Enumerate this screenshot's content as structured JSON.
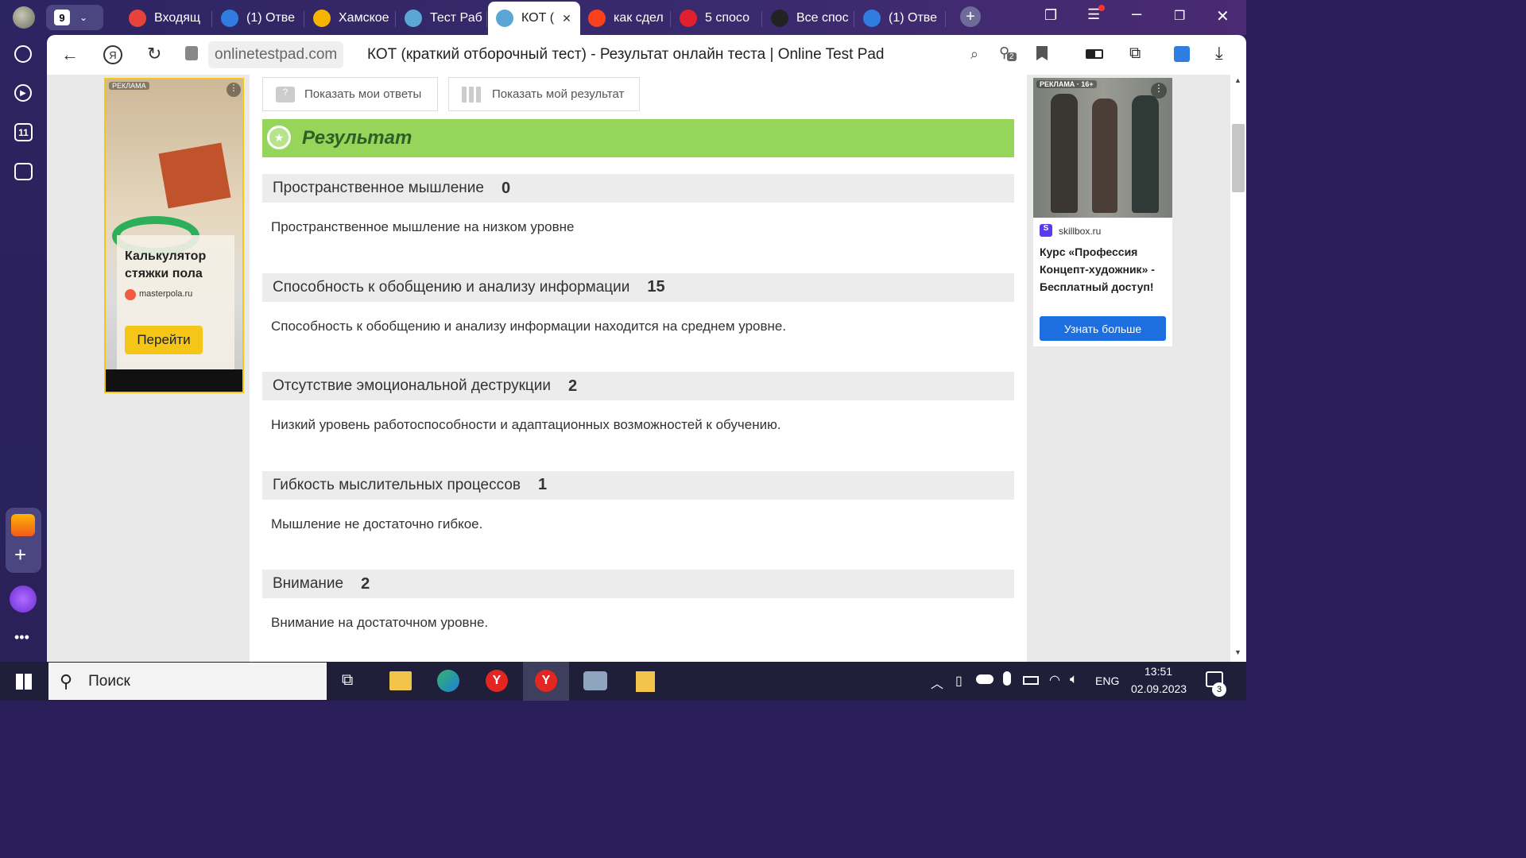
{
  "tabs": {
    "count": "9",
    "items": [
      {
        "label": "Входящ",
        "icon": "mail-icon",
        "color": "#e8433a"
      },
      {
        "label": "(1) Отве",
        "icon": "question-icon",
        "color": "#2f7de1"
      },
      {
        "label": "Хамское",
        "icon": "pencil-icon",
        "color": "#f4b400"
      },
      {
        "label": "Тест Раб",
        "icon": "onlinetestpad-icon",
        "color": "#5aa7d6"
      },
      {
        "label": "КОТ (",
        "icon": "onlinetestpad-icon",
        "color": "#5aa7d6"
      },
      {
        "label": "как сдел",
        "icon": "yandex-icon",
        "color": "#fc3f1d"
      },
      {
        "label": "5 спосо",
        "icon": "medical-icon",
        "color": "#e0202e"
      },
      {
        "label": "Все спос",
        "icon": "spark-icon",
        "color": "#222222"
      },
      {
        "label": "(1) Отве",
        "icon": "question-icon",
        "color": "#2f7de1"
      }
    ]
  },
  "address": {
    "domain": "onlinetestpad.com",
    "title": "КОТ (краткий отборочный тест) - Результат онлайн теста | Online Test Pad",
    "ext_badge": "2"
  },
  "sidebar": {
    "calendar_day": "11"
  },
  "page": {
    "btn_answers": "Показать мои ответы",
    "btn_result": "Показать мой результат",
    "result_title": "Результат",
    "sections": [
      {
        "name": "Пространственное мышление",
        "score": "0",
        "text": "Пространственное мышление на низком уровне"
      },
      {
        "name": "Способность к обобщению и анализу информации",
        "score": "15",
        "text": "Способность к обобщению и анализу информации находится на среднем уровне."
      },
      {
        "name": "Отсутствие эмоциональной деструкции",
        "score": "2",
        "text": "Низкий уровень работоспособности и адаптационных возможностей к обучению."
      },
      {
        "name": "Гибкость мыслительных процессов",
        "score": "1",
        "text": "Мышление не достаточно гибкое."
      },
      {
        "name": "Внимание",
        "score": "2",
        "text": "Внимание на достаточном уровне."
      }
    ]
  },
  "ad_left": {
    "badge": "РЕКЛАМА",
    "title": "Калькулятор стяжки пола",
    "domain": "masterpola.ru",
    "button": "Перейти"
  },
  "ad_right": {
    "badge": "РЕКЛАМА · 16+",
    "domain": "skillbox.ru",
    "title": "Курс «Профессия Концепт-художник» - Бесплатный доступ!",
    "button": "Узнать больше"
  },
  "taskbar": {
    "search": "Поиск",
    "lang": "ENG",
    "time": "13:51",
    "date": "02.09.2023",
    "notif": "3"
  },
  "colors": {
    "result_green": "#95d55a",
    "link_blue": "#2f7de1",
    "ad_yellow": "#f5c518"
  }
}
